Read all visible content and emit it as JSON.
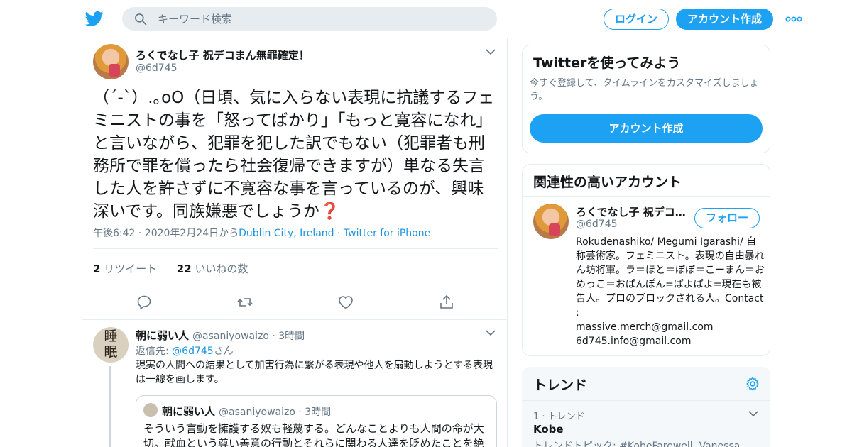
{
  "header": {
    "search_placeholder": "キーワード検索",
    "login_label": "ログイン",
    "signup_label": "アカウント作成"
  },
  "tweet": {
    "author_name": "ろくでなし子 祝デコまん無罪確定！",
    "author_handle": "@6d745",
    "text": "（´-`）.｡oO（日頃、気に入らない表現に抗議するフェミニストの事を「怒ってばかり」「もっと寛容になれ」と言いながら、犯罪を犯した訳でもない（犯罪者も刑務所で罪を償ったら社会復帰できますが）単なる失言した人を許さずに不寛容な事を言っているのが、興味深いです。同族嫌悪でしょうか",
    "emoji": "❓",
    "timestamp": "午後6:42 · 2020年2月24日から",
    "location": "Dublin City, Ireland",
    "source": "Twitter for iPhone",
    "retweet_count": "2",
    "retweet_label": "リツイート",
    "like_count": "22",
    "like_label": "いいねの数"
  },
  "reply": {
    "avatar_text_top": "睡",
    "avatar_text_bottom": "眠",
    "author_name": "朝に弱い人",
    "author_handle": "@asaniyowaizo",
    "time": "3時間",
    "reply_to_prefix": "返信先: ",
    "reply_to_handle": "@6d745",
    "reply_to_suffix": "さん",
    "text": "現実の人間への結果として加害行為に繋がる表現や他人を扇動しようとする表現は一線を画します。",
    "quote": {
      "author_name": "朝に弱い人",
      "author_handle": "@asaniyowaizo",
      "time": "3時間",
      "text": "そういう言動を擁護する奴も軽蔑する。どんなことよりも人間の命が大切。献血という尊い善意の行動とそれらに関わる人達を貶めたことを絶"
    }
  },
  "sidebar": {
    "signup_card": {
      "title": "Twitterを使ってみよう",
      "description": "今すぐ登録して、タイムラインをカスタマイズしましょう。",
      "button_label": "アカウント作成"
    },
    "related": {
      "title": "関連性の高いアカウント",
      "account_name": "ろくでなし子 祝デコまん無罪確定！",
      "account_handle": "@6d745",
      "follow_label": "フォロー",
      "bio_lines": [
        "Rokudenashiko/ Megumi Igarashi/ 自称芸術家。フェミニスト。表現の自由暴れん坊将軍。ラ＝ほと＝ぼぼ＝こーまん＝おめっこ＝おぱんぽん=ぱよぱよ=現在も被告人。プロのブロックされる人。Contact :",
        "massive.merch@gmail.com",
        "6d745.info@gmail.com"
      ]
    },
    "trends": {
      "title": "トレンド",
      "items": [
        {
          "meta": "1 · トレンド",
          "name": "Kobe",
          "topic": "トレンドトピック: #KobeFarewell, Vanessa"
        }
      ]
    }
  },
  "colors": {
    "brand": "#1da1f2",
    "link": "#1b95e0",
    "muted": "#657786",
    "border": "#e6ecf0"
  },
  "icons": {
    "logo": "twitter-bird-icon",
    "search": "search-icon",
    "more": "more-dots-icon",
    "reply": "reply-icon",
    "retweet": "retweet-icon",
    "like": "heart-icon",
    "share": "share-icon",
    "settings": "gear-icon",
    "caret": "chevron-down-icon"
  }
}
